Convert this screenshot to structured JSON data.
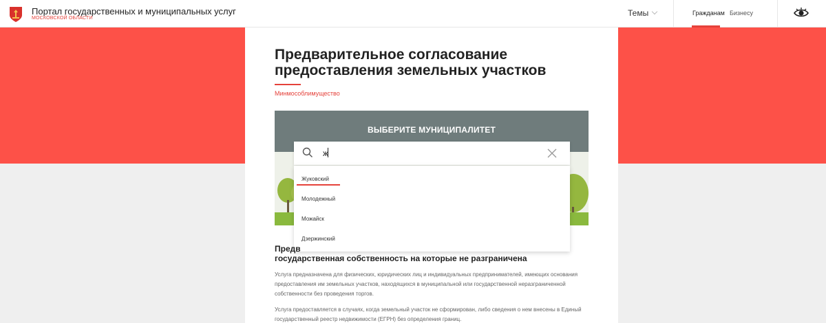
{
  "header": {
    "portal_title": "Портал государственных и муниципальных услуг",
    "portal_subtitle": "МОСКОВСКОЙ ОБЛАСТИ",
    "themes_label": "Темы",
    "audience_tabs": [
      {
        "label": "Гражданам",
        "active": true
      },
      {
        "label": "Бизнесу",
        "active": false
      }
    ],
    "icons": {
      "logo": "coat-of-arms-icon",
      "accessibility": "eye-icon"
    }
  },
  "service": {
    "title": "Предварительное согласование предоставления земельных участков",
    "ministry": "Минмособлимущество"
  },
  "banner": {
    "heading": "ВЫБЕРИТЕ МУНИЦИПАЛИТЕТ"
  },
  "search": {
    "value": "ж",
    "placeholder": ""
  },
  "dropdown": {
    "items": [
      "Жуковский",
      "Молодежный",
      "Можайск",
      "Дзержинский"
    ],
    "highlighted_index": 0
  },
  "body": {
    "sub_heading_start": "Предв",
    "sub_heading_line2": "государственная собственность на которые не разграничена",
    "paragraph1": "Услуга предназначена для физических, юридических лиц и индивидуальных предпринимателей, имеющих основания предоставления им земельных участков, находящихся в муниципальной или государственной неразграниченной собственности без проведения торгов.",
    "paragraph2": "Услуга предоставляется в случаях, когда земельный участок не сформирован, либо сведения о нем внесены в Единый государственный реестр недвижимости (ЕГРН) без определения границ."
  },
  "colors": {
    "accent": "#e5413a",
    "band": "#fd5148",
    "background": "#efefef"
  }
}
